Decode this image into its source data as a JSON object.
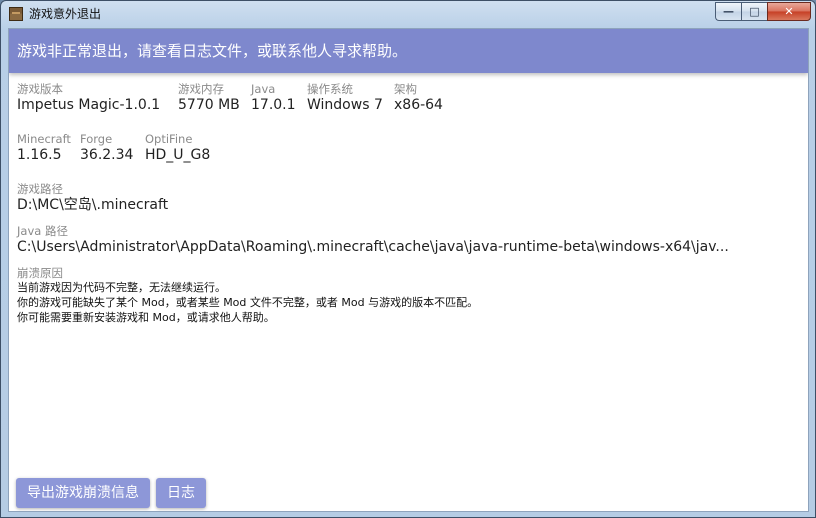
{
  "window": {
    "title": "游戏意外退出",
    "controls": {
      "minimize": "—",
      "maximize": "□",
      "close": "✕"
    }
  },
  "banner": "游戏非正常退出，请查看日志文件，或联系他人寻求帮助。",
  "info_row1": [
    {
      "label": "游戏版本",
      "value": "Impetus Magic-1.0.1"
    },
    {
      "label": "游戏内存",
      "value": "5770 MB"
    },
    {
      "label": "Java",
      "value": "17.0.1"
    },
    {
      "label": "操作系统",
      "value": "Windows 7"
    },
    {
      "label": "架构",
      "value": "x86-64"
    }
  ],
  "info_row2": [
    {
      "label": "Minecraft",
      "value": "1.16.5"
    },
    {
      "label": "Forge",
      "value": "36.2.34"
    },
    {
      "label": "OptiFine",
      "value": "HD_U_G8"
    }
  ],
  "game_path": {
    "label": "游戏路径",
    "value": "D:\\MC\\空岛\\.minecraft"
  },
  "java_path": {
    "label": "Java 路径",
    "value": "C:\\Users\\Administrator\\AppData\\Roaming\\.minecraft\\cache\\java\\java-runtime-beta\\windows-x64\\jav..."
  },
  "crash": {
    "label": "崩溃原因",
    "lines": [
      "当前游戏因为代码不完整，无法继续运行。",
      "你的游戏可能缺失了某个 Mod，或者某些 Mod 文件不完整，或者 Mod 与游戏的版本不匹配。",
      "你可能需要重新安装游戏和 Mod，或请求他人帮助。"
    ]
  },
  "buttons": {
    "export": "导出游戏崩溃信息",
    "log": "日志"
  },
  "colors": {
    "banner": "#7e88cd",
    "button": "#8d97d8"
  }
}
